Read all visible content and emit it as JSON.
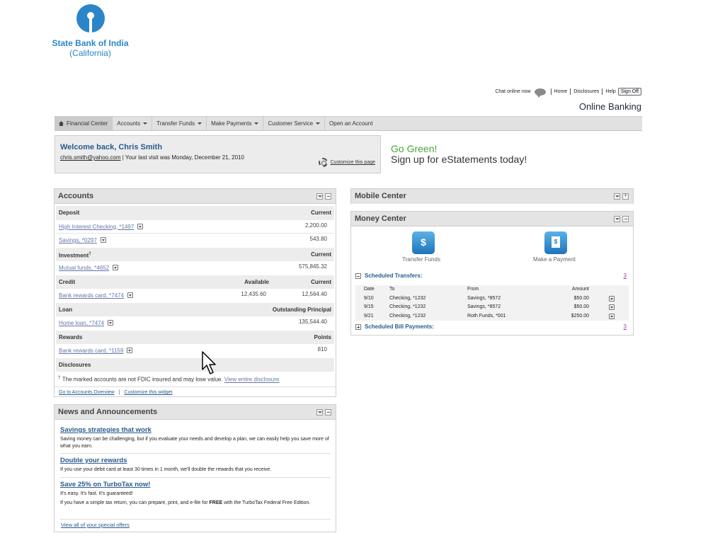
{
  "brand": {
    "name": "State Bank of India",
    "sub": "(California)",
    "color": "#2a86c8"
  },
  "toplinks": {
    "chat": "Chat online now",
    "home": "Home",
    "disclosures": "Disclosures",
    "help": "Help",
    "signoff": "Sign Off"
  },
  "page_title": "Online Banking",
  "nav": [
    {
      "label": "Financial Center",
      "active": true
    },
    {
      "label": "Accounts",
      "dropdown": true
    },
    {
      "label": "Transfer Funds",
      "dropdown": true
    },
    {
      "label": "Make Payments",
      "dropdown": true
    },
    {
      "label": "Customer Service",
      "dropdown": true
    },
    {
      "label": "Open an Account"
    }
  ],
  "welcome": {
    "title": "Welcome back, Chris Smith",
    "email": "chris.smith@yahoo.com",
    "last_visit": " | Your last visit was Monday, December 21, 2010",
    "customize": "Customize this page"
  },
  "promo": {
    "line1": "Go Green!",
    "line2": "Sign up for eStatements today!",
    "accent": "#4aa33a"
  },
  "accounts": {
    "title": "Accounts",
    "sections": [
      {
        "name": "Deposit",
        "col_right": "Current"
      },
      {
        "name": "Investment",
        "col_right": "Current"
      },
      {
        "name": "Credit",
        "col_mid": "Available",
        "col_right": "Current"
      },
      {
        "name": "Loan",
        "col_right": "Outstanding Principal"
      },
      {
        "name": "Rewards",
        "col_right": "Points"
      },
      {
        "name": "Disclosures"
      }
    ],
    "dagger": "†",
    "rows": [
      {
        "name": "High Interest Checking, *1497",
        "value": "2,200.00"
      },
      {
        "name": "Savings, *0297",
        "value": "543.80"
      },
      {
        "name": "Mutual funds, *4652",
        "value": "575,845.32"
      },
      {
        "name": "Bank rewards card, *7474",
        "available": "12,435.60",
        "value": "12,564.40"
      },
      {
        "name": "Home loan, *7474",
        "value": "135,544.40"
      },
      {
        "name": "Bank rewards card, *1159",
        "value": "810"
      }
    ],
    "disclosure_text": " The marked accounts are not FDIC insured and may lose value. ",
    "disclosure_link": "View entire disclosure",
    "footer_overview": "Go to Accounts Overview",
    "footer_sep": "|",
    "footer_customize": "Customize this widget"
  },
  "news": {
    "title": "News and Announcements",
    "items": [
      {
        "title": "Savings strategies that work",
        "body": "Saving money can be challenging, but if you evaluate your needs and develop a plan, we can easily help you save more of what you earn."
      },
      {
        "title": "Double your rewards",
        "body": "If you use your debit card at least 30 times in 1 month, we'll double the rewards that you receive."
      },
      {
        "title": "Save 25% on TurboTax now!",
        "body": "It's easy. It's fast. It's guaranteed!",
        "body2_pre": "If you have a simple tax return, you can prepare, print, and e-file for ",
        "body2_bold": "FREE",
        "body2_post": " with the TurboTax Federal Free Edition."
      }
    ],
    "footer": "View all of your special offers"
  },
  "mobile_center": {
    "title": "Mobile Center"
  },
  "money_center": {
    "title": "Money Center",
    "transfer_label": "Transfer Funds",
    "pay_label": "Make a Payment",
    "scheduled_transfers": "Scheduled Transfers:",
    "transfers_count": "3",
    "columns": [
      "Date",
      "To",
      "From",
      "Amount"
    ],
    "transfers": [
      {
        "date": "9/10",
        "to": "Checking, *1232",
        "from": "Savings, *8572",
        "amount": "$50.00"
      },
      {
        "date": "9/15",
        "to": "Checking, *1232",
        "from": "Savings, *8572",
        "amount": "$50.00"
      },
      {
        "date": "9/21",
        "to": "Checking, *1232",
        "from": "Roth Funds, *001",
        "amount": "$250.00"
      }
    ],
    "scheduled_bills": "Scheduled Bill Payments:",
    "bills_count": "3"
  }
}
